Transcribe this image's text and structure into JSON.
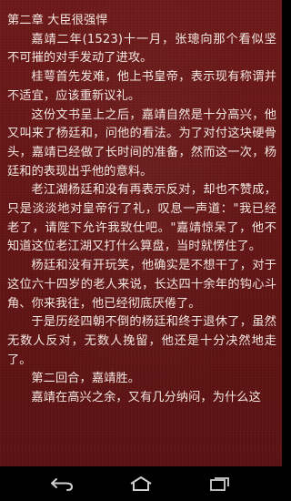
{
  "chapter": {
    "title": "第二章 大臣很强悍"
  },
  "paragraphs": [
    "嘉靖二年(1523)十一月，张璁向那个看似坚不可摧的对手发动了进攻。",
    "桂萼首先发难，他上书皇帝，表示现有称谓并不适宜，应该重新议礼。",
    "这份文书呈上之后，嘉靖自然是十分高兴，他又叫来了杨廷和，问他的看法。为了对付这块硬骨头，嘉靖已经做了长时间的准备，然而这一次，杨廷和的表现出乎他的意料。",
    "老江湖杨廷和没有再表示反对，却也不赞成，只是淡淡地对皇帝行了礼，叹息一声道：\"我已经老了，请陛下允许我致仕吧。\"嘉靖惊呆了，他不知道这位老江湖又打什么算盘，当时就愣住了。",
    "杨廷和没有开玩笑，他确实是不想干了，对于这位六十四岁的老人来说，长达四十余年的钩心斗角、你来我往，他已经彻底厌倦了。",
    "于是历经四朝不倒的杨廷和终于退休了，虽然无数人反对，无数人挽留，他还是十分决然地走了。",
    "第二回合，嘉靖胜。",
    "嘉靖在高兴之余，又有几分纳闷，为什么这"
  ],
  "navbar": {
    "back_icon": "back-arrow-icon",
    "home_icon": "home-icon",
    "recent_icon": "recent-apps-icon",
    "icon_color": "#cfcfcf"
  },
  "colors": {
    "page_background": "#651616",
    "text": "#f2e6e0"
  }
}
